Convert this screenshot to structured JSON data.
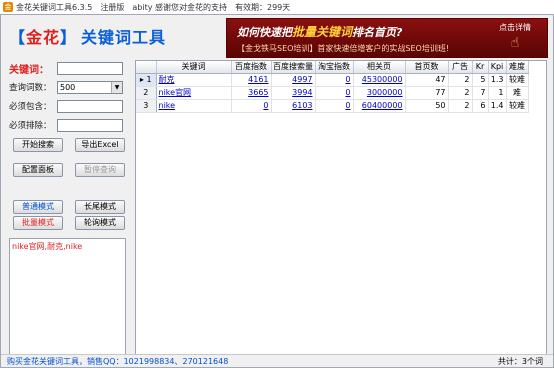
{
  "titlebar": {
    "title": "金花关键词工具6.3.5",
    "edition": "注册版",
    "user": "abity 感谢您对金花的支持",
    "validity": "有效期：299天"
  },
  "logo": {
    "open": "【",
    "gold": "金花",
    "close": "】",
    "name": "关键词工具"
  },
  "banner": {
    "headline_pre": "如何快速把",
    "headline_hl": "批量关键词",
    "headline_post": "排名首页?",
    "subline": "【金戈铁马SEO培训】首家快速倍增客户的实战SEO培训班!",
    "detail_label": "点击详情"
  },
  "form": {
    "keyword_label": "关键词：",
    "keyword_value": "",
    "count_label": "查询词数：",
    "count_value": "500",
    "include_label": "必须包含：",
    "include_value": "",
    "exclude_label": "必须排除：",
    "exclude_value": ""
  },
  "buttons": {
    "start_search": "开始搜索",
    "export_excel": "导出Excel",
    "config_panel": "配置面板",
    "pause_query": "暂停查询",
    "normal_mode": "普通模式",
    "longtail_mode": "长尾模式",
    "batch_mode": "批量模式",
    "poll_mode": "轮询模式"
  },
  "log_text": "nike官网,耐克,nike",
  "table": {
    "columns": [
      "关键词",
      "百度指数",
      "百度搜索量",
      "淘宝指数",
      "相关页",
      "首页数",
      "广告",
      "Kr",
      "Kpi",
      "难度"
    ],
    "rows": [
      {
        "n": "1",
        "keyword": "耐克",
        "baidu_index": "4161",
        "baidu_search": "4997",
        "taobao": "0",
        "related": "45300000",
        "homepage": "47",
        "ads": "2",
        "kr": "5",
        "kpi": "1.3",
        "difficulty": "较难"
      },
      {
        "n": "2",
        "keyword": "nike官网",
        "baidu_index": "3665",
        "baidu_search": "3994",
        "taobao": "0",
        "related": "3000000",
        "homepage": "77",
        "ads": "2",
        "kr": "7",
        "kpi": "1",
        "difficulty": "难"
      },
      {
        "n": "3",
        "keyword": "nike",
        "baidu_index": "0",
        "baidu_search": "6103",
        "taobao": "0",
        "related": "60400000",
        "homepage": "50",
        "ads": "2",
        "kr": "6",
        "kpi": "1.4",
        "difficulty": "较难"
      }
    ]
  },
  "status": {
    "promo": "购买金花关键词工具，销售QQ：1021998834、270121648",
    "count": "共计：3个词"
  }
}
